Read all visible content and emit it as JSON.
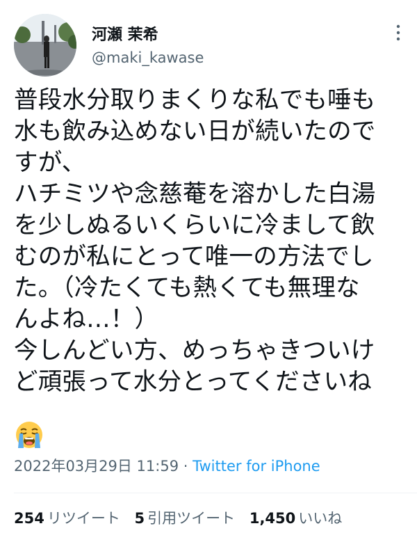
{
  "author": {
    "display_name": "河瀬 茉希",
    "username": "@maki_kawase"
  },
  "tweet": {
    "lines": [
      "普段水分取りまくりな私でも唾も",
      "水も飲み込めない日が続いたので",
      "すが、",
      "ハチミツや念慈菴を溶かした白湯",
      "を少しぬるいくらいに冷まして飲",
      "むのが私にとって唯一の方法でし",
      "た。（冷たくても熱くても無理な",
      "んよね…！）",
      "今しんどい方、めっちゃきついけ",
      "ど頑張って水分とってくださいね"
    ],
    "emoji": "loudly-crying-face-icon"
  },
  "meta": {
    "timestamp": "2022年03月29日 11:59",
    "separator": "·",
    "source": "Twitter for iPhone"
  },
  "stats": {
    "retweets_count": "254",
    "retweets_label": "リツイート",
    "quotes_count": "5",
    "quotes_label": "引用ツイート",
    "likes_count": "1,450",
    "likes_label": "いいね"
  },
  "colors": {
    "text": "#0f1419",
    "secondary": "#536471",
    "link": "#1d9bf0",
    "divider": "#eff3f4"
  }
}
